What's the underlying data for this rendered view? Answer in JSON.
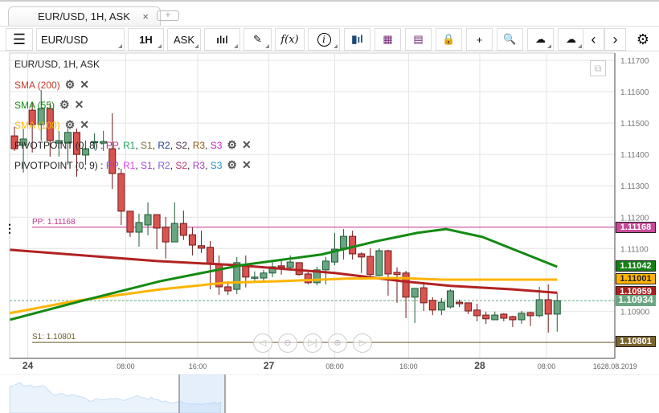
{
  "tab": {
    "title": "EUR/USD, 1H, ASK",
    "close": "×",
    "new": "+"
  },
  "toolbar": {
    "symbol": "EUR/USD",
    "period": "1H",
    "side": "ASK",
    "fx": "f(x)"
  },
  "legend": {
    "title": "EUR/USD, 1H, ASK",
    "sma200": "SMA (200)",
    "sma55": "SMA (55)",
    "sma100": "SMA (100)",
    "pivot8": "PIVOTPOINT (0, 8)",
    "pivot9": "PIVOTPOINT (0, 9)",
    "gear": "⚙",
    "close": "✕",
    "pivot8_items": [
      {
        "t": "PP",
        "c": "#d63384"
      },
      {
        "t": "R1",
        "c": "#20a060"
      },
      {
        "t": "S1",
        "c": "#7a6a30"
      },
      {
        "t": "R2",
        "c": "#2040a0"
      },
      {
        "t": "S2",
        "c": "#503050"
      },
      {
        "t": "R3",
        "c": "#8a5a10"
      },
      {
        "t": "S3",
        "c": "#c020c0"
      }
    ],
    "pivot9_items": [
      {
        "t": "PP",
        "c": "#a040e0"
      },
      {
        "t": "R1",
        "c": "#e040e0"
      },
      {
        "t": "S1",
        "c": "#a040e0"
      },
      {
        "t": "R2",
        "c": "#8060e0"
      },
      {
        "t": "S2",
        "c": "#c03070"
      },
      {
        "t": "R3",
        "c": "#a040c0"
      },
      {
        "t": "S3",
        "c": "#2090c0"
      }
    ]
  },
  "chart_data": {
    "type": "candlestick",
    "ylim": [
      1.1075,
      1.11723
    ],
    "yticks": [
      "1.11700",
      "1.11600",
      "1.11500",
      "1.11400",
      "1.11300",
      "1.11200",
      "1.11100",
      "1.10900"
    ],
    "xticks": [
      {
        "i": 1.5,
        "t": "24",
        "bold": true
      },
      {
        "i": 12.5,
        "t": "08:00"
      },
      {
        "i": 20.6,
        "t": "16:00"
      },
      {
        "i": 28.6,
        "t": "27",
        "bold": true
      },
      {
        "i": 36,
        "t": "08:00"
      },
      {
        "i": 44.3,
        "t": "16:00"
      },
      {
        "i": 52.3,
        "t": "28",
        "bold": true
      },
      {
        "i": 59.8,
        "t": "08:00"
      },
      {
        "i": 67.5,
        "t": "1628.08.2019"
      }
    ],
    "candles": [
      [
        1.11459,
        1.11488,
        1.11411,
        1.11418
      ],
      [
        1.11429,
        1.11482,
        1.11342,
        1.11449
      ],
      [
        1.11541,
        1.11564,
        1.11406,
        1.11495
      ],
      [
        1.11495,
        1.11605,
        1.11444,
        1.11546
      ],
      [
        1.11546,
        1.11564,
        1.11393,
        1.11444
      ],
      [
        1.11436,
        1.11475,
        1.11393,
        1.11444
      ],
      [
        1.11436,
        1.11482,
        1.11367,
        1.1147
      ],
      [
        1.1147,
        1.11482,
        1.11329,
        1.114
      ],
      [
        1.11398,
        1.11444,
        1.11367,
        1.11418
      ],
      [
        1.11439,
        1.11467,
        1.11416,
        1.11441
      ],
      [
        1.11436,
        1.11475,
        1.11411,
        1.11441
      ],
      [
        1.11418,
        1.11531,
        1.1129,
        1.11339
      ],
      [
        1.11339,
        1.11354,
        1.11175,
        1.11219
      ],
      [
        1.11219,
        1.11219,
        1.11137,
        1.11152
      ],
      [
        1.11152,
        1.11211,
        1.11106,
        1.11183
      ],
      [
        1.11175,
        1.11247,
        1.11142,
        1.11208
      ],
      [
        1.11208,
        1.11208,
        1.11098,
        1.11165
      ],
      [
        1.11168,
        1.11201,
        1.11068,
        1.11121
      ],
      [
        1.11121,
        1.11247,
        1.11121,
        1.1118
      ],
      [
        1.1118,
        1.11221,
        1.11127,
        1.11142
      ],
      [
        1.11144,
        1.11168,
        1.11078,
        1.11111
      ],
      [
        1.11109,
        1.11157,
        1.11086,
        1.11101
      ],
      [
        1.11104,
        1.11124,
        1.1097,
        1.1105
      ],
      [
        1.1105,
        1.11078,
        1.10952,
        1.10978
      ],
      [
        1.10978,
        1.10996,
        1.10952,
        1.10965
      ],
      [
        1.1097,
        1.11073,
        1.10955,
        1.11055
      ],
      [
        1.11047,
        1.11078,
        1.10976,
        1.11009
      ],
      [
        1.11006,
        1.11027,
        1.10996,
        1.11009
      ],
      [
        1.11006,
        1.11032,
        1.10991,
        1.11022
      ],
      [
        1.11022,
        1.1106,
        1.11009,
        1.11042
      ],
      [
        1.11045,
        1.1106,
        1.11017,
        1.1104
      ],
      [
        1.1104,
        1.11078,
        1.11029,
        1.11057
      ],
      [
        1.11055,
        1.11055,
        1.11014,
        1.11017
      ],
      [
        1.11019,
        1.11027,
        1.10986,
        1.10991
      ],
      [
        1.10991,
        1.11042,
        1.10983,
        1.11032
      ],
      [
        1.11032,
        1.11073,
        1.10986,
        1.1106
      ],
      [
        1.11057,
        1.1115,
        1.11047,
        1.11098
      ],
      [
        1.11101,
        1.11162,
        1.11065,
        1.11139
      ],
      [
        1.11139,
        1.11157,
        1.11065,
        1.11083
      ],
      [
        1.11083,
        1.11088,
        1.11022,
        1.11073
      ],
      [
        1.11075,
        1.11101,
        1.11009,
        1.11017
      ],
      [
        1.11014,
        1.11101,
        1.11011,
        1.11093
      ],
      [
        1.11093,
        1.11096,
        1.1095,
        1.11019
      ],
      [
        1.11024,
        1.1104,
        1.10927,
        1.11017
      ],
      [
        1.11022,
        1.11029,
        1.10878,
        1.10945
      ],
      [
        1.10945,
        1.10973,
        1.10863,
        1.10973
      ],
      [
        1.10975,
        1.10991,
        1.10901,
        1.10927
      ],
      [
        1.10935,
        1.10945,
        1.10888,
        1.10904
      ],
      [
        1.10904,
        1.10942,
        1.10888,
        1.10929
      ],
      [
        1.10914,
        1.1097,
        1.10909,
        1.10965
      ],
      [
        1.10929,
        1.10937,
        1.10914,
        1.10924
      ],
      [
        1.10927,
        1.10927,
        1.10891,
        1.10901
      ],
      [
        1.10904,
        1.10924,
        1.10868,
        1.10886
      ],
      [
        1.10888,
        1.10899,
        1.1086,
        1.10876
      ],
      [
        1.10873,
        1.10899,
        1.10873,
        1.10888
      ],
      [
        1.10891,
        1.10894,
        1.10868,
        1.10878
      ],
      [
        1.10883,
        1.10886,
        1.1085,
        1.10873
      ],
      [
        1.10873,
        1.10901,
        1.1086,
        1.10894
      ],
      [
        1.10896,
        1.10899,
        1.10853,
        1.10886
      ],
      [
        1.10886,
        1.10978,
        1.10881,
        1.10937
      ],
      [
        1.10937,
        1.10986,
        1.10832,
        1.10891
      ],
      [
        1.10891,
        1.10958,
        1.10835,
        1.10934
      ]
    ],
    "sma200": {
      "color": "#b22222",
      "points": [
        [
          -0.5,
          1.11096
        ],
        [
          16,
          1.1106
        ],
        [
          25,
          1.11047
        ],
        [
          36,
          1.11022
        ],
        [
          43.5,
          1.10996
        ],
        [
          49,
          1.10981
        ],
        [
          56,
          1.1097
        ],
        [
          61,
          1.10959
        ]
      ]
    },
    "sma55": {
      "color": "#138a13",
      "points": [
        [
          -0.5,
          1.10873
        ],
        [
          7.4,
          1.10932
        ],
        [
          16.4,
          1.10996
        ],
        [
          25.5,
          1.11047
        ],
        [
          34.5,
          1.11081
        ],
        [
          40.8,
          1.11124
        ],
        [
          45.3,
          1.1115
        ],
        [
          48.5,
          1.11162
        ],
        [
          52.6,
          1.11137
        ],
        [
          57.1,
          1.11086
        ],
        [
          61,
          1.11042
        ]
      ]
    },
    "sma100": {
      "color": "#ffb400",
      "points": [
        [
          -0.5,
          1.10894
        ],
        [
          6.6,
          1.10932
        ],
        [
          16.4,
          1.1097
        ],
        [
          23.7,
          1.10991
        ],
        [
          30,
          1.10996
        ],
        [
          37.2,
          1.11004
        ],
        [
          43.5,
          1.11006
        ],
        [
          48,
          1.11001
        ],
        [
          57,
          1.11001
        ],
        [
          61,
          1.11001
        ]
      ]
    },
    "pp": {
      "label": "PP: 1.11168",
      "value": 1.11168,
      "color": "#c0308a"
    },
    "s1": {
      "label": "S1: 1.10801",
      "value": 1.10801,
      "color": "#6b5a2a"
    },
    "last_price": 1.10934
  },
  "price_labels": {
    "pp": "1.11168",
    "sma55": "1.11042",
    "sma100": "1.11001",
    "sma200": "1.10959",
    "last": "1.10934",
    "s1": "1.10801"
  },
  "colors": {
    "up": "#6aa581",
    "down": "#d9534f",
    "pp": "#c84a98",
    "sma55": "#138013",
    "sma100": "#ffb400",
    "sma200": "#a81e1e",
    "last": "#6aa581",
    "s1": "#7a6530"
  }
}
